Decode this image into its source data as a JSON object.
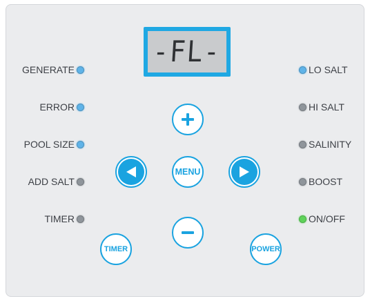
{
  "display": {
    "text": "-FL-"
  },
  "left_indicators": [
    {
      "label": "GENERATE",
      "led_color": "#5fb3e8"
    },
    {
      "label": "ERROR",
      "led_color": "#5fb3e8"
    },
    {
      "label": "POOL SIZE",
      "led_color": "#5fb3e8"
    },
    {
      "label": "ADD SALT",
      "led_color": "#8f959b"
    },
    {
      "label": "TIMER",
      "led_color": "#8f959b"
    }
  ],
  "right_indicators": [
    {
      "label": "LO SALT",
      "led_color": "#5fb3e8"
    },
    {
      "label": "HI SALT",
      "led_color": "#8f959b"
    },
    {
      "label": "SALINITY",
      "led_color": "#8f959b"
    },
    {
      "label": "BOOST",
      "led_color": "#8f959b"
    },
    {
      "label": "ON/OFF",
      "led_color": "#5fd35a"
    }
  ],
  "buttons": {
    "plus": {
      "icon": "plus-icon"
    },
    "left": {
      "icon": "left-arrow-icon"
    },
    "menu": {
      "label": "MENU"
    },
    "right": {
      "icon": "right-arrow-icon"
    },
    "minus": {
      "icon": "minus-icon"
    },
    "timer": {
      "label": "TIMER"
    },
    "power": {
      "label": "POWER"
    }
  },
  "colors": {
    "accent": "#1aa3e0",
    "panel": "#ebecee",
    "lcd": "#c9cbcd",
    "led_blue": "#5fb3e8",
    "led_gray": "#8f959b",
    "led_green": "#5fd35a"
  }
}
